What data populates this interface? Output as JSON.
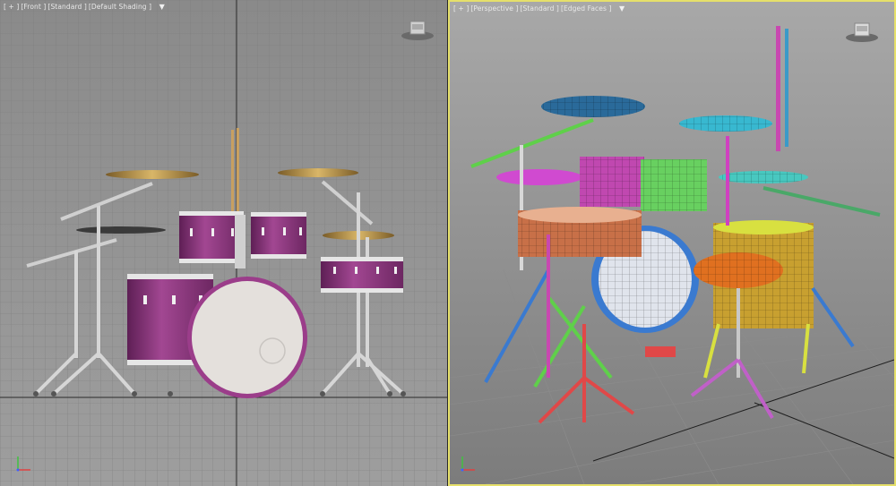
{
  "viewports": {
    "front": {
      "labels": [
        "[ + ]",
        "[Front ]",
        "[Standard ]",
        "[Default Shading ]"
      ],
      "filter_icon": "funnel-icon"
    },
    "perspective": {
      "labels": [
        "[ + ]",
        "[Perspective ]",
        "[Standard ]",
        "[Edged Faces ]"
      ],
      "filter_icon": "funnel-icon"
    }
  },
  "colors": {
    "active_border": "#e6e06a",
    "drum_purple": "#9b3d8a",
    "cymbal_gold": "#b8944a",
    "wire_magenta": "#d040c0",
    "wire_green": "#5fd04a",
    "wire_cyan": "#3ab8c8",
    "wire_orange": "#e07020",
    "wire_yellow": "#d8e040",
    "wire_red": "#e04848",
    "wire_blue": "#3a7ad0"
  },
  "icons": [
    "viewcube-icon",
    "axis-tripod-icon",
    "funnel-icon"
  ]
}
